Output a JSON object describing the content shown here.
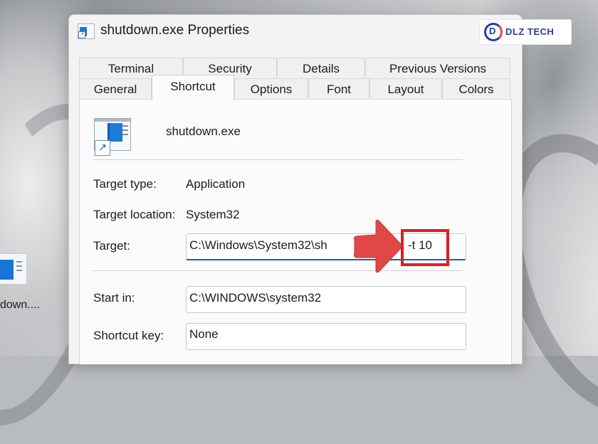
{
  "window": {
    "title": "shutdown.exe Properties"
  },
  "watermark": {
    "logo_text": "DLZ TECH",
    "logo_mark": "D"
  },
  "tabs": {
    "row_back": [
      "Terminal",
      "Security",
      "Details",
      "Previous Versions"
    ],
    "row_front": [
      "General",
      "Shortcut",
      "Options",
      "Font",
      "Layout",
      "Colors"
    ],
    "active": "Shortcut"
  },
  "shortcut": {
    "file_name": "shutdown.exe",
    "target_type_label": "Target type:",
    "target_type_value": "Application",
    "target_location_label": "Target location:",
    "target_location_value": "System32",
    "target_label": "Target:",
    "target_value": "C:\\Windows\\System32\\shutdown.exe -s -t 10",
    "target_visible_start": "C:\\Windows\\System32\\sh",
    "target_visible_end": "-t 10",
    "start_in_label": "Start in:",
    "start_in_value": "C:\\WINDOWS\\system32",
    "shortcut_key_label": "Shortcut key:",
    "shortcut_key_value": "None"
  },
  "desktop": {
    "icon_label": "down...."
  },
  "annotation": {
    "arrow_color": "#e04848",
    "box_color": "#dd1e24"
  },
  "icons": {
    "title_icon": "shortcut-app-icon",
    "file_icon": "shortcut-app-icon",
    "annotation_arrow": "right-arrow-icon"
  }
}
